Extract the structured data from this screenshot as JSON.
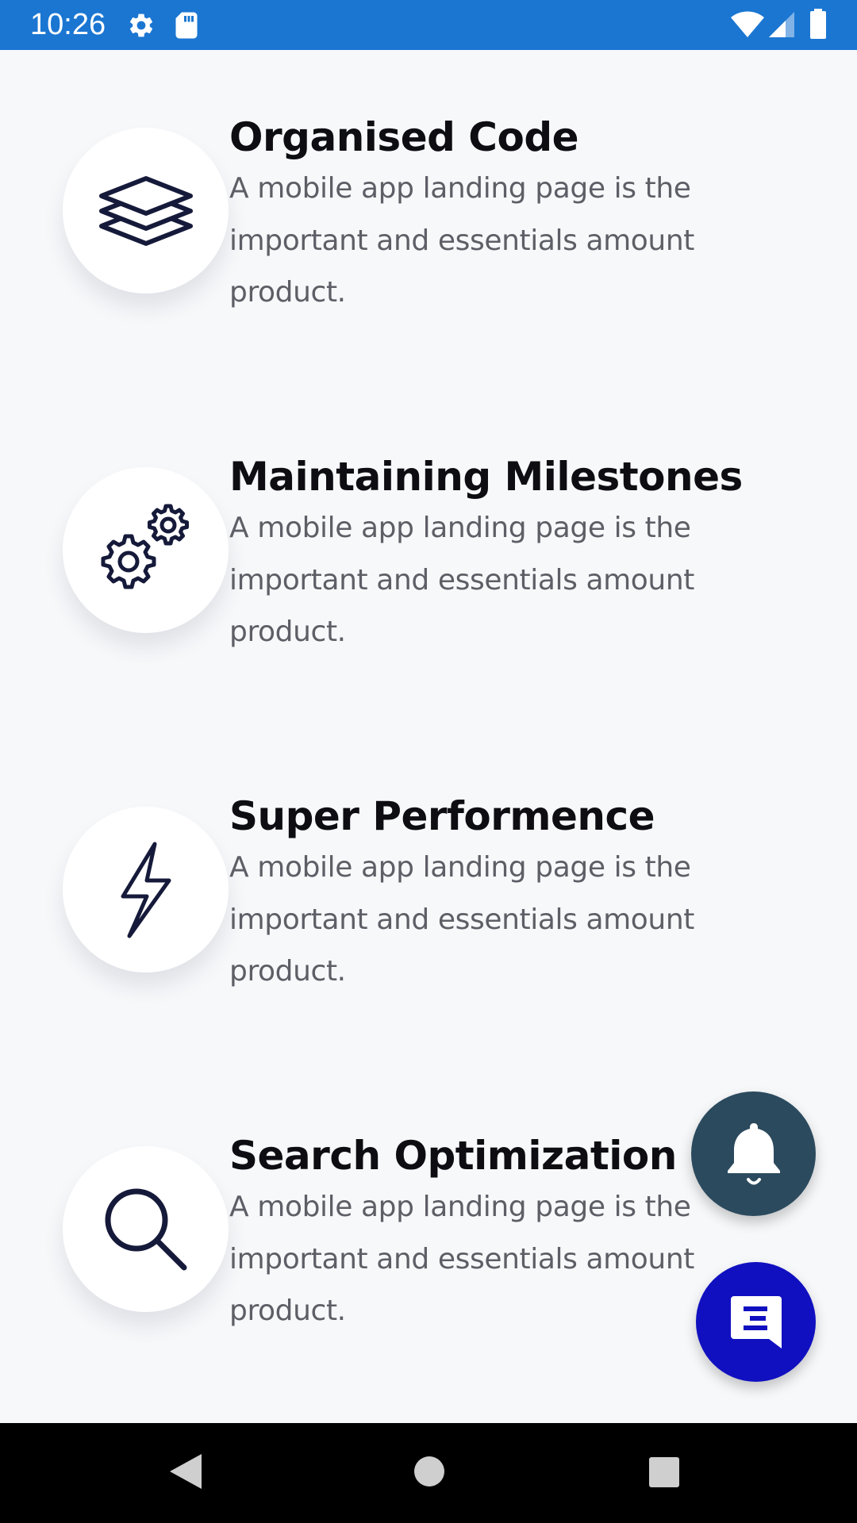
{
  "status_bar": {
    "time": "10:26",
    "background": "#1b76d2",
    "left_icons": [
      "settings-icon",
      "sd-card-icon"
    ],
    "right_icons": [
      "wifi-icon",
      "cell-signal-icon",
      "battery-icon"
    ]
  },
  "features": [
    {
      "icon": "layers-icon",
      "title": "Organised Code",
      "description": "A mobile app landing page is the important and essentials amount product."
    },
    {
      "icon": "gears-icon",
      "title": "Maintaining Milestones",
      "description": "A mobile app landing page is the important and essentials amount product."
    },
    {
      "icon": "lightning-icon",
      "title": "Super Performence",
      "description": "A mobile app landing page is the important and essentials amount product."
    },
    {
      "icon": "search-icon",
      "title": "Search Optimization",
      "description": "A mobile app landing page is the important and essentials amount product."
    }
  ],
  "fabs": {
    "notification": {
      "icon": "bell-icon",
      "color": "#2b4a5e"
    },
    "chat": {
      "icon": "chat-icon",
      "color": "#1010c0"
    }
  },
  "nav_bar": {
    "buttons": [
      "back-icon",
      "home-icon",
      "recents-icon"
    ]
  }
}
